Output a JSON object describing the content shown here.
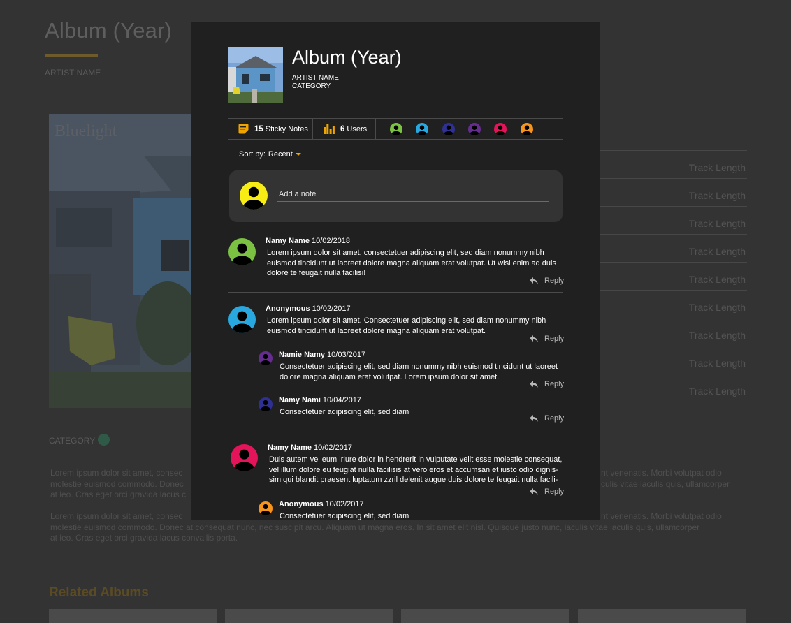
{
  "background": {
    "title": "Album (Year)",
    "artist": "ARTIST NAME",
    "category_label": "CATEGORY",
    "track_length_label": "Track Length",
    "tracks": [
      "Track Length",
      "Track Length",
      "Track Length",
      "Track Length",
      "Track Length",
      "Track Length",
      "Track Length",
      "Track Length",
      "Track Length"
    ],
    "paragraph_1_left": "Lorem ipsum dolor sit amet, consec",
    "paragraph_1_left_2": "molestie euismod commodo. Donec",
    "paragraph_1_left_3": "at leo. Cras eget orci gravida lacus c",
    "paragraph_1_right": "nt venenatis. Morbi volutpat odio",
    "paragraph_1_right_2": "culis vitae iaculis quis, ullamcorper",
    "paragraph_2_line1": "Lorem ipsum dolor sit amet, consec",
    "paragraph_2_line1_right": "nt venenatis. Morbi volutpat odio",
    "paragraph_2_line2": "molestie euismod commodo. Donec at consequat nunc, nec suscipit arcu. Aliquam ut magna eros. In sit amet elit nisl. Quisque justo nunc, iaculis vitae iaculis quis, ullamcorper",
    "paragraph_2_line3": "at leo. Cras eget orci gravida lacus convallis porta.",
    "related_title": "Related Albums",
    "colors": {
      "accent": "#6f5a2c",
      "category_dot": "#2f5a48"
    }
  },
  "modal": {
    "title": "Album (Year)",
    "artist": "ARTIST NAME",
    "category": "CATEGORY",
    "stats": {
      "notes_count": "15",
      "notes_label": "Sticky Notes",
      "users_count": "6",
      "users_label": "Users"
    },
    "user_colors": [
      "#7cc242",
      "#29a8e0",
      "#2e3192",
      "#662d91",
      "#e4145a",
      "#f7941d"
    ],
    "sort": {
      "label": "Sort by:",
      "value": "Recent"
    },
    "add_note": {
      "placeholder": "Add a note",
      "avatar_color": "#f7ec13"
    },
    "reply_label": "Reply",
    "notes": [
      {
        "name": "Namy Name",
        "date": "10/02/2018",
        "color": "#7cc242",
        "lines": [
          "Lorem ipsum dolor sit amet, consectetuer adipiscing elit, sed diam nonummy nibh",
          "euismod tincidunt ut laoreet dolore magna aliquam erat volutpat. Ut wisi enim ad duis",
          "dolore te feugait nulla facilisi!"
        ]
      },
      {
        "name": "Anonymous",
        "date": "10/02/2017",
        "color": "#29a8e0",
        "lines": [
          "Lorem ipsum dolor sit amet. Consectetuer adipiscing elit, sed diam nonummy nibh",
          "euismod tincidunt ut laoreet dolore magna aliquam erat volutpat."
        ],
        "replies": [
          {
            "name": "Namie Namy",
            "date": "10/03/2017",
            "color": "#662d91",
            "lines": [
              "Consectetuer adipiscing elit, sed diam nonummy nibh euismod tincidunt ut laoreet",
              "dolore magna aliquam erat volutpat. Lorem ipsum dolor sit amet."
            ]
          },
          {
            "name": "Namy Nami",
            "date": "10/04/2017",
            "color": "#2e3192",
            "lines": [
              "Consectetuer adipiscing elit, sed diam"
            ]
          }
        ]
      },
      {
        "name": "Namy Name",
        "date": "10/02/2017",
        "color": "#e4145a",
        "lines": [
          "Duis autem vel eum iriure dolor in hendrerit in vulputate velit esse molestie consequat,",
          "vel illum dolore eu feugiat nulla facilisis at vero eros et accumsan et iusto odio dignis-",
          "sim qui blandit praesent luptatum zzril delenit augue duis dolore te feugait nulla facili-"
        ],
        "replies": [
          {
            "name": "Anonymous",
            "date": "10/02/2017",
            "color": "#f7941d",
            "lines": [
              "Consectetuer adipiscing elit, sed diam"
            ]
          }
        ]
      }
    ]
  }
}
